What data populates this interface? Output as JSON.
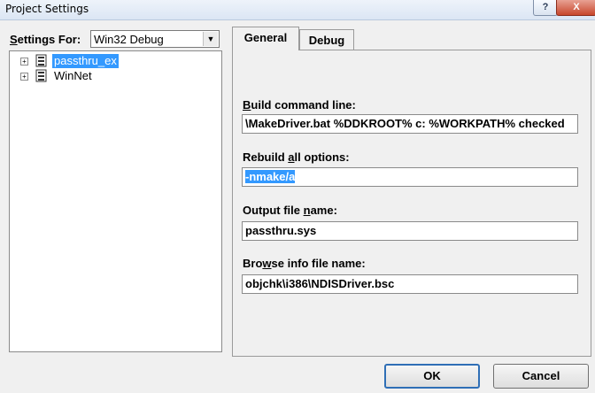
{
  "window": {
    "title": "Project Settings",
    "help_glyph": "?",
    "close_glyph": "X"
  },
  "settings_for": {
    "label_ul": "S",
    "label_rest": "ettings For:",
    "value": "Win32 Debug"
  },
  "tree": {
    "items": [
      {
        "label": "passthru_ex",
        "selected": true
      },
      {
        "label": "WinNet",
        "selected": false
      }
    ],
    "expander_glyph": "+"
  },
  "tabs": [
    {
      "label": "General",
      "active": true
    },
    {
      "label": "Debug",
      "active": false
    }
  ],
  "fields": {
    "build_cmd": {
      "label_ul": "B",
      "label_rest": "uild command line:",
      "value": "\\MakeDriver.bat %DDKROOT% c: %WORKPATH% checked"
    },
    "rebuild": {
      "label_pre": "Rebuild ",
      "label_ul": "a",
      "label_rest": "ll options:",
      "value": "-nmake/a"
    },
    "output": {
      "label_pre": "Output file ",
      "label_ul": "n",
      "label_rest": "ame:",
      "value": "passthru.sys"
    },
    "browse": {
      "label_pre": "Bro",
      "label_ul": "w",
      "label_rest": "se info file name:",
      "value": "objchk\\i386\\NDISDriver.bsc"
    }
  },
  "buttons": {
    "ok": "OK",
    "cancel": "Cancel"
  },
  "colors": {
    "selection": "#3399ff",
    "background": "#f0f0f0"
  }
}
